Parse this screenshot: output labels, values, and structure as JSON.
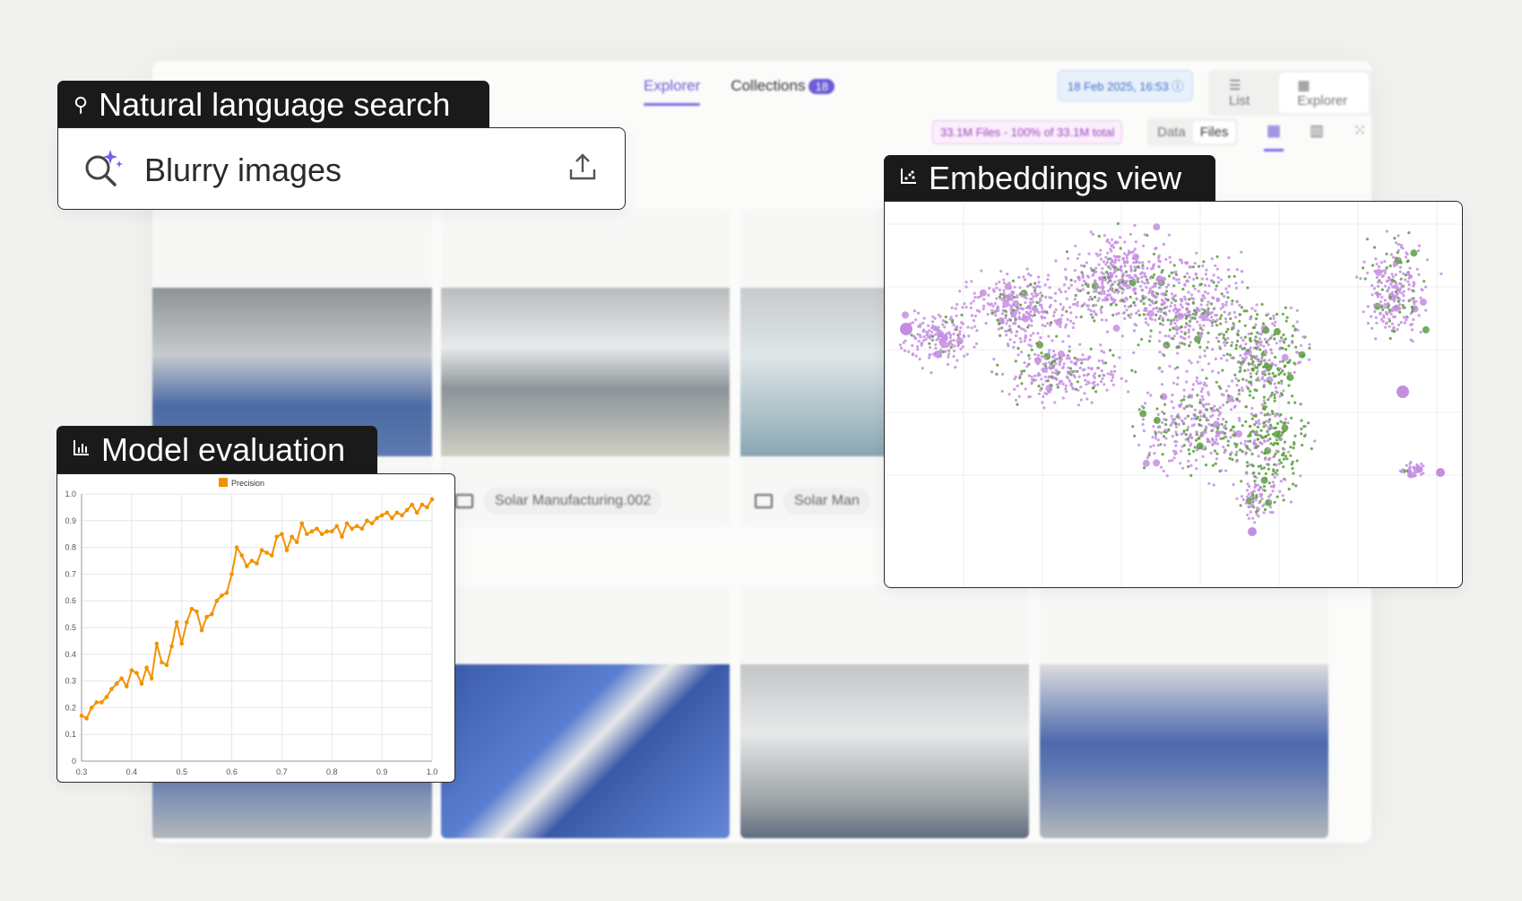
{
  "app": {
    "tabs": [
      {
        "label": "Explorer",
        "active": true
      },
      {
        "label": "Collections",
        "count": "18"
      }
    ],
    "timestamp": "18 Feb 2025, 16:53",
    "view_modes": [
      "List",
      "Explorer"
    ],
    "files_summary": "33.1M Files - 100% of 33.1M total",
    "data_files_toggle": [
      "Data",
      "Files"
    ],
    "cards": [
      {
        "label": "Solar Manufacturing.002"
      },
      {
        "label": "Solar Man"
      }
    ]
  },
  "search_panel": {
    "tag": "Natural language search",
    "query": "Blurry images"
  },
  "embeddings_panel": {
    "tag": "Embeddings view",
    "colors": {
      "cluster_a": "#c48ee0",
      "cluster_b": "#5a9e3e"
    }
  },
  "eval_panel": {
    "tag": "Model evaluation"
  },
  "chart_data": {
    "type": "line",
    "title": "",
    "xlabel": "",
    "ylabel": "",
    "xlim": [
      0.3,
      1.0
    ],
    "ylim": [
      0,
      1.0
    ],
    "x_ticks": [
      "0.3",
      "0.4",
      "0.5",
      "0.6",
      "0.7",
      "0.8",
      "0.9",
      "1.0"
    ],
    "y_ticks": [
      "0",
      "0.1",
      "0.2",
      "0.3",
      "0.4",
      "0.5",
      "0.6",
      "0.7",
      "0.8",
      "0.9",
      "1.0"
    ],
    "grid": true,
    "legend_position": "top-center",
    "series": [
      {
        "name": "Precision",
        "color": "#f39200",
        "x": [
          0.3,
          0.31,
          0.32,
          0.33,
          0.34,
          0.35,
          0.36,
          0.37,
          0.38,
          0.39,
          0.4,
          0.41,
          0.42,
          0.43,
          0.44,
          0.45,
          0.46,
          0.47,
          0.48,
          0.49,
          0.5,
          0.51,
          0.52,
          0.53,
          0.54,
          0.55,
          0.56,
          0.57,
          0.58,
          0.59,
          0.6,
          0.61,
          0.62,
          0.63,
          0.64,
          0.65,
          0.66,
          0.67,
          0.68,
          0.69,
          0.7,
          0.71,
          0.72,
          0.73,
          0.74,
          0.75,
          0.76,
          0.77,
          0.78,
          0.79,
          0.8,
          0.81,
          0.82,
          0.83,
          0.84,
          0.85,
          0.86,
          0.87,
          0.88,
          0.89,
          0.9,
          0.91,
          0.92,
          0.93,
          0.94,
          0.95,
          0.96,
          0.97,
          0.98,
          0.99,
          1.0
        ],
        "values": [
          0.17,
          0.16,
          0.2,
          0.22,
          0.22,
          0.24,
          0.27,
          0.29,
          0.31,
          0.28,
          0.34,
          0.33,
          0.29,
          0.35,
          0.31,
          0.44,
          0.37,
          0.36,
          0.43,
          0.52,
          0.44,
          0.52,
          0.57,
          0.56,
          0.49,
          0.54,
          0.55,
          0.6,
          0.62,
          0.63,
          0.7,
          0.8,
          0.77,
          0.73,
          0.75,
          0.74,
          0.79,
          0.78,
          0.77,
          0.84,
          0.85,
          0.79,
          0.84,
          0.82,
          0.89,
          0.85,
          0.86,
          0.87,
          0.85,
          0.86,
          0.86,
          0.88,
          0.84,
          0.89,
          0.87,
          0.88,
          0.87,
          0.9,
          0.89,
          0.91,
          0.92,
          0.93,
          0.91,
          0.93,
          0.92,
          0.94,
          0.96,
          0.93,
          0.96,
          0.95,
          0.98
        ]
      }
    ]
  }
}
